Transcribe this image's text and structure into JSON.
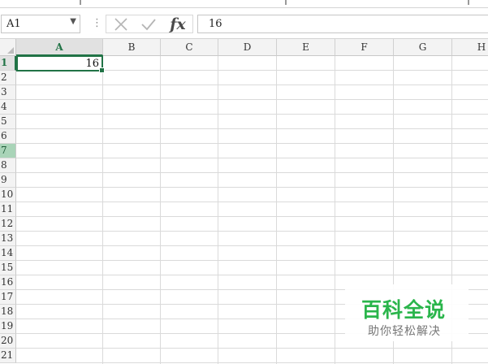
{
  "name_box": {
    "value": "A1"
  },
  "formula_bar": {
    "value": "16",
    "icons": [
      "cancel-icon",
      "enter-icon",
      "insert-function-icon"
    ],
    "fx_label": "fx"
  },
  "sheet": {
    "columns": [
      "A",
      "B",
      "C",
      "D",
      "E",
      "F",
      "G",
      "H"
    ],
    "rows": [
      "1",
      "2",
      "3",
      "4",
      "5",
      "6",
      "7",
      "8",
      "9",
      "10",
      "11",
      "12",
      "13",
      "14",
      "15",
      "16",
      "17",
      "18",
      "19",
      "20",
      "21"
    ],
    "active_column": "A",
    "active_row": "1",
    "highlighted_row": "7",
    "selected_cell": {
      "ref": "A1",
      "value": "16"
    }
  },
  "watermark": {
    "title": "百科全说",
    "subtitle": "助你轻松解决"
  },
  "colors": {
    "accent": "#217346",
    "row_highlight": "#a9d4b8",
    "watermark_green": "#2ab54b"
  }
}
